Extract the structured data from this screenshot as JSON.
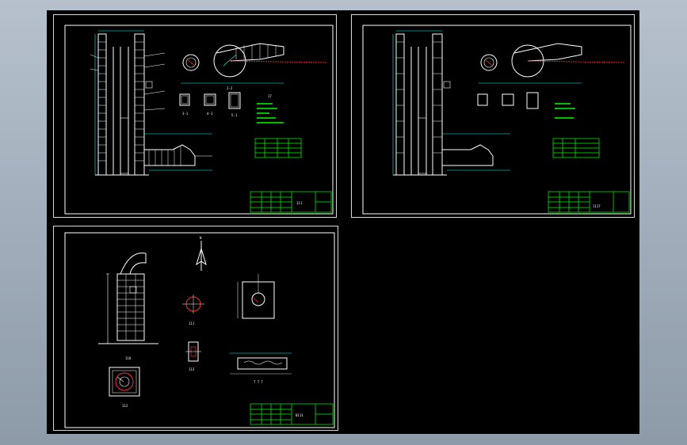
{
  "colors": {
    "background": "#8d9aa8",
    "viewport": "#000000",
    "sheet_border": "#d8d8d8",
    "drawing_white": "#ffffff",
    "dim_cyan": "#00ffff",
    "title_green": "#00ff00",
    "accent_red": "#ff3030"
  },
  "sheets": [
    {
      "id": "sheet-1",
      "title_text": "111"
    },
    {
      "id": "sheet-2",
      "title_text": "1117"
    },
    {
      "id": "sheet-3",
      "title_text": "0111"
    }
  ],
  "labels": {
    "section_label": "1-1",
    "plan_label": "2-2",
    "note_title": "17",
    "detail_a": "3-1",
    "detail_b": "4-1",
    "detail_c": "5-1",
    "north": "N",
    "chimney_label": "110",
    "flue_label": "111",
    "base_label": "112",
    "pipe_label": "113",
    "duct_label": "T T T"
  }
}
